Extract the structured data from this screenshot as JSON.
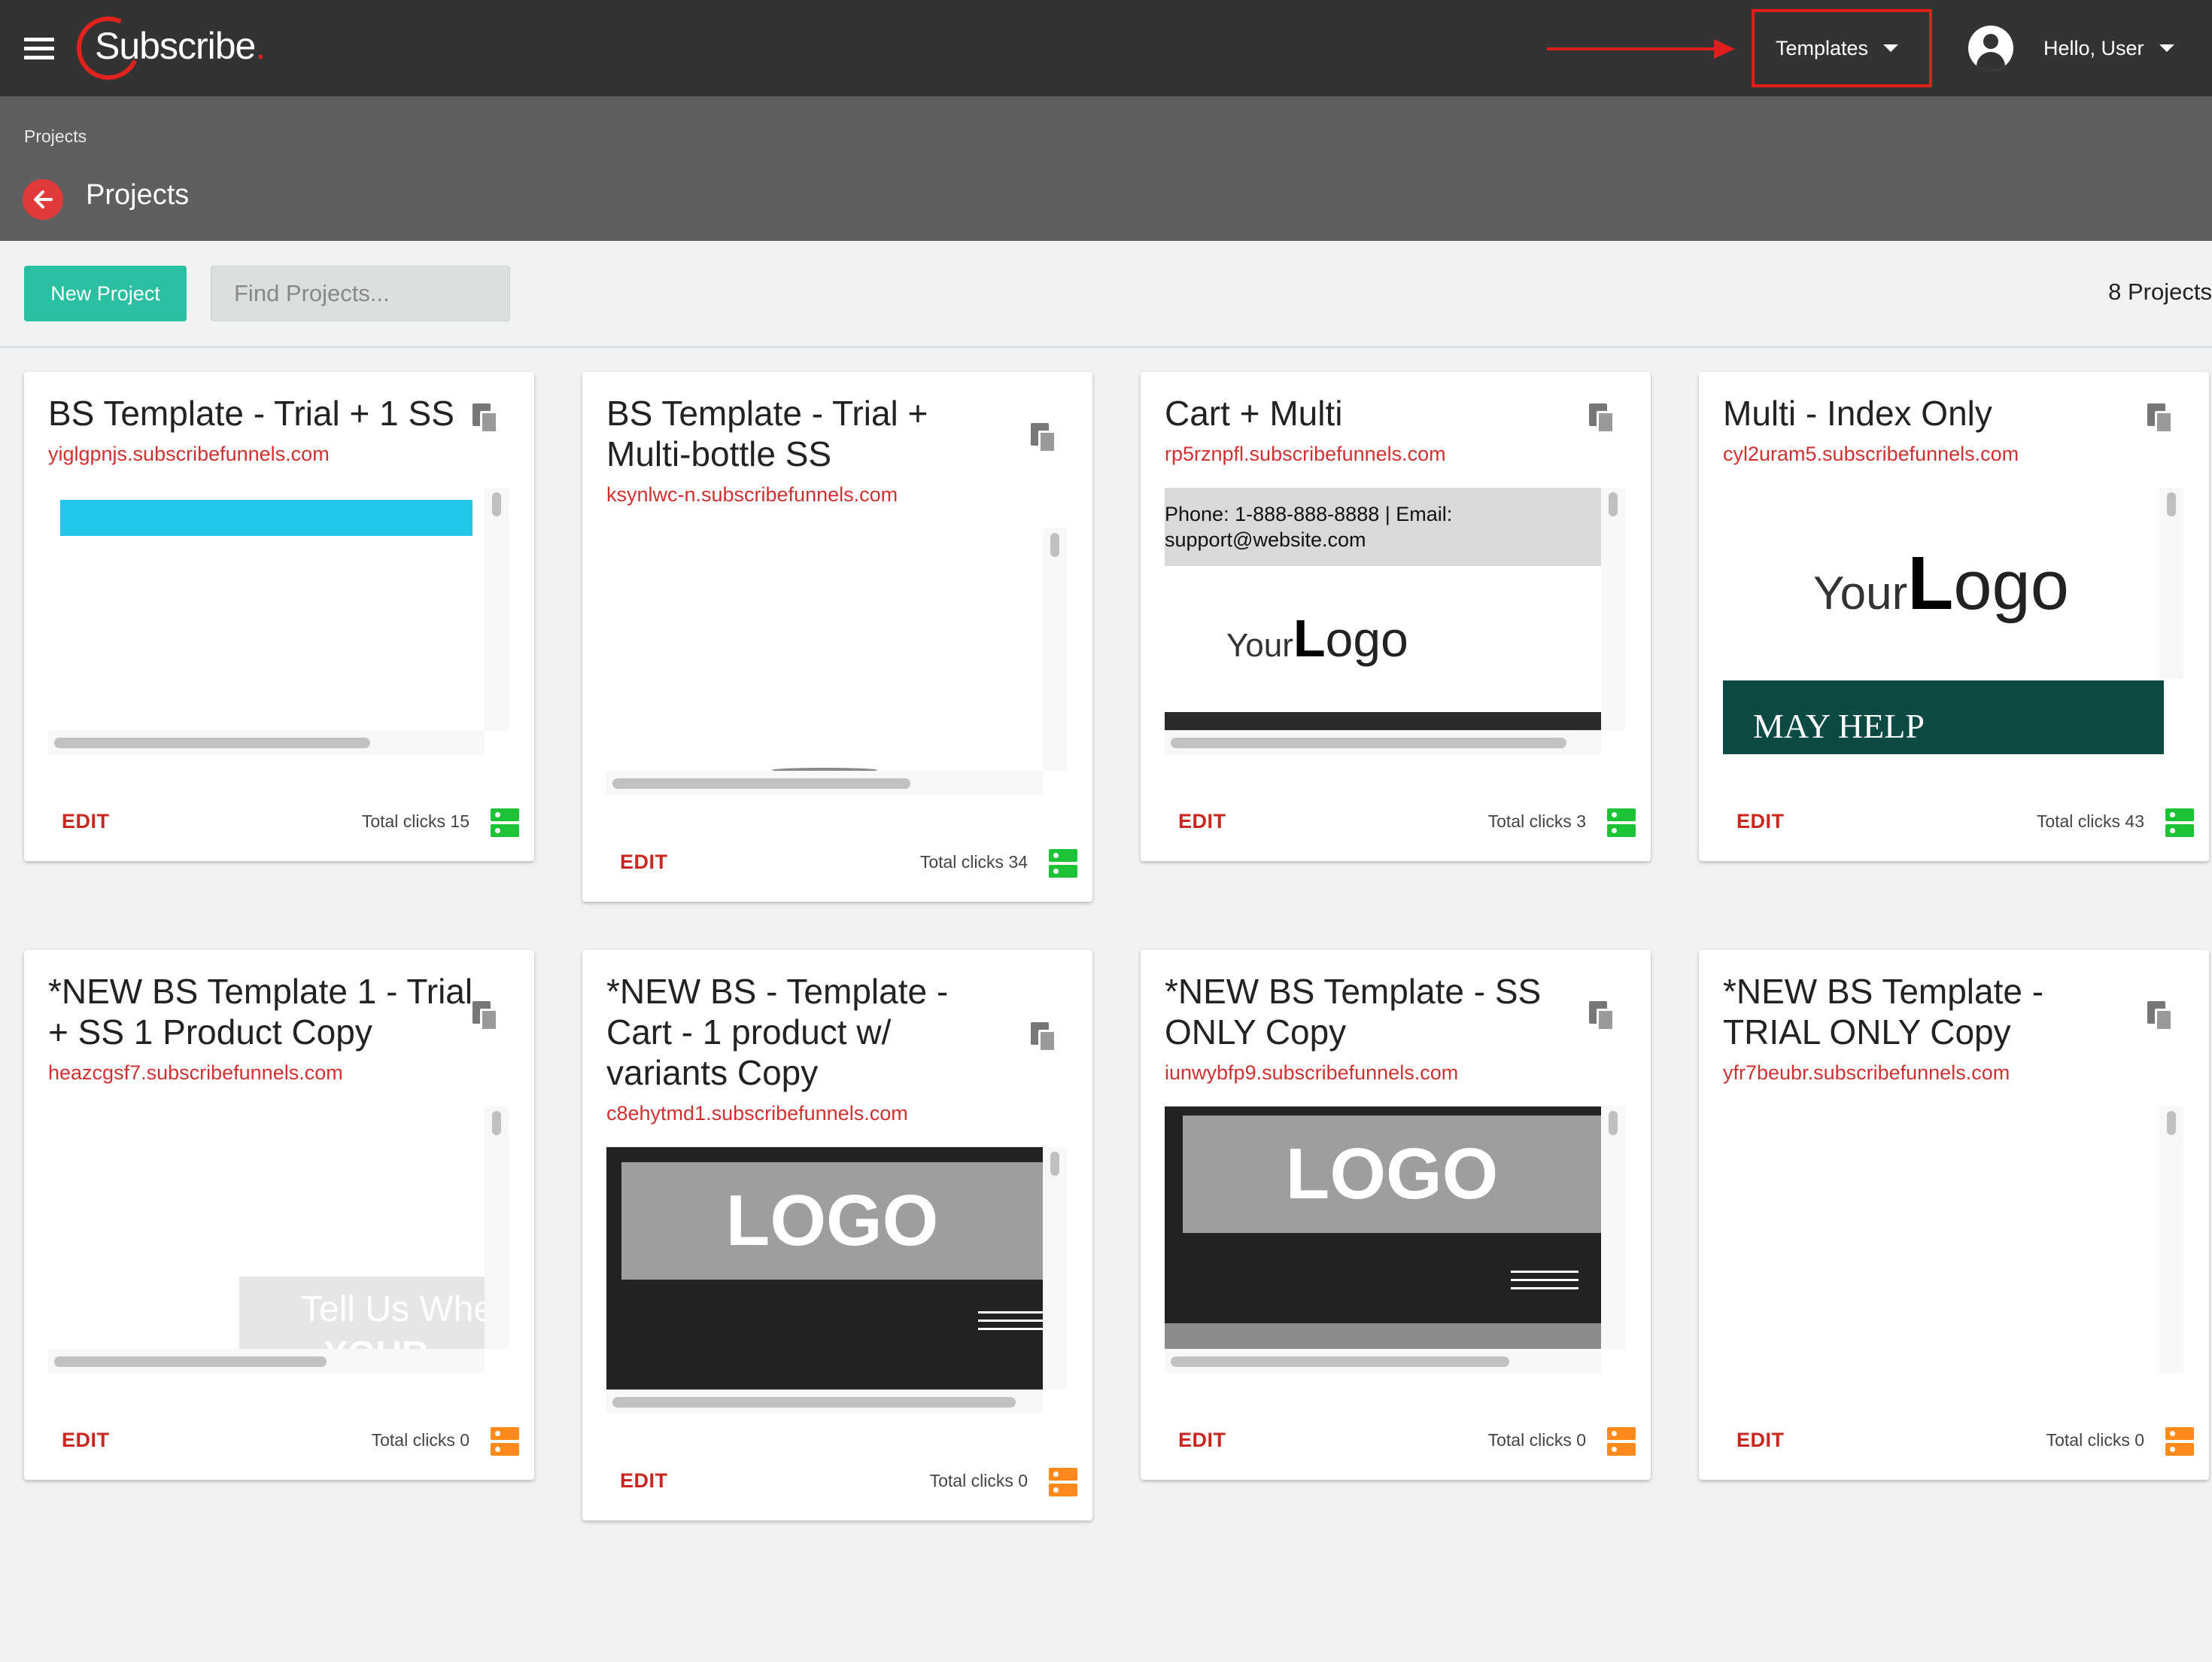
{
  "header": {
    "logo_text": "Subscribe",
    "templates_label": "Templates",
    "user_label": "Hello, User"
  },
  "subheader": {
    "breadcrumb": "Projects",
    "title": "Projects"
  },
  "toolbar": {
    "new_project_label": "New Project",
    "search_placeholder": "Find Projects...",
    "projects_count": "8 Projects"
  },
  "projects": [
    {
      "title": "BS Template - Trial + 1 SS",
      "url": "yiglgpnjs.subscribefunnels.com",
      "edit_label": "EDIT",
      "clicks_label": "Total clicks 15",
      "status": "green"
    },
    {
      "title": "BS Template - Trial + Multi-bottle SS",
      "url": "ksynlwc-n.subscribefunnels.com",
      "edit_label": "EDIT",
      "clicks_label": "Total clicks 34",
      "status": "green"
    },
    {
      "title": "Cart + Multi",
      "url": "rp5rznpfl.subscribefunnels.com",
      "edit_label": "EDIT",
      "clicks_label": "Total clicks 3",
      "status": "green",
      "preview": {
        "phone_text": "Phone: 1-888-888-8888 | Email: support@website.com",
        "logo_your": "Your",
        "logo_l": "L",
        "logo_ogo": "ogo"
      }
    },
    {
      "title": "Multi - Index Only",
      "url": "cyl2uram5.subscribefunnels.com",
      "edit_label": "EDIT",
      "clicks_label": "Total clicks 43",
      "status": "green",
      "preview": {
        "logo_your": "Your",
        "logo_l": "L",
        "logo_ogo": "ogo",
        "banner_text": "MAY HELP"
      }
    },
    {
      "title": "*NEW BS Template 1 - Trial + SS 1 Product Copy",
      "url": "heazcgsf7.subscribefunnels.com",
      "edit_label": "EDIT",
      "clicks_label": "Total clicks 0",
      "status": "orange",
      "preview": {
        "overlay_text": "Tell Us Whe",
        "overlay_text2": "YOUR"
      }
    },
    {
      "title": "*NEW BS - Template - Cart - 1 product w/ variants Copy",
      "url": "c8ehytmd1.subscribefunnels.com",
      "edit_label": "EDIT",
      "clicks_label": "Total clicks 0",
      "status": "orange",
      "preview": {
        "logo_text": "LOGO"
      }
    },
    {
      "title": "*NEW BS Template - SS ONLY Copy",
      "url": "iunwybfp9.subscribefunnels.com",
      "edit_label": "EDIT",
      "clicks_label": "Total clicks 0",
      "status": "orange",
      "preview": {
        "logo_text": "LOGO"
      }
    },
    {
      "title": "*NEW BS Template - TRIAL ONLY Copy",
      "url": "yfr7beubr.subscribefunnels.com",
      "edit_label": "EDIT",
      "clicks_label": "Total clicks 0",
      "status": "orange"
    }
  ],
  "colors": {
    "topbar": "#333333",
    "subheader": "#5f5f5f",
    "accent_red": "#d13030",
    "new_button": "#2bbfa1",
    "status_green": "#1cc334",
    "status_orange": "#ff8a1c",
    "highlight_annotation": "#e21d1d"
  },
  "icons": [
    "menu-icon",
    "back-arrow-icon",
    "caret-down-icon",
    "account-icon",
    "copy-icon",
    "server-status-icon",
    "annotation-arrow"
  ]
}
